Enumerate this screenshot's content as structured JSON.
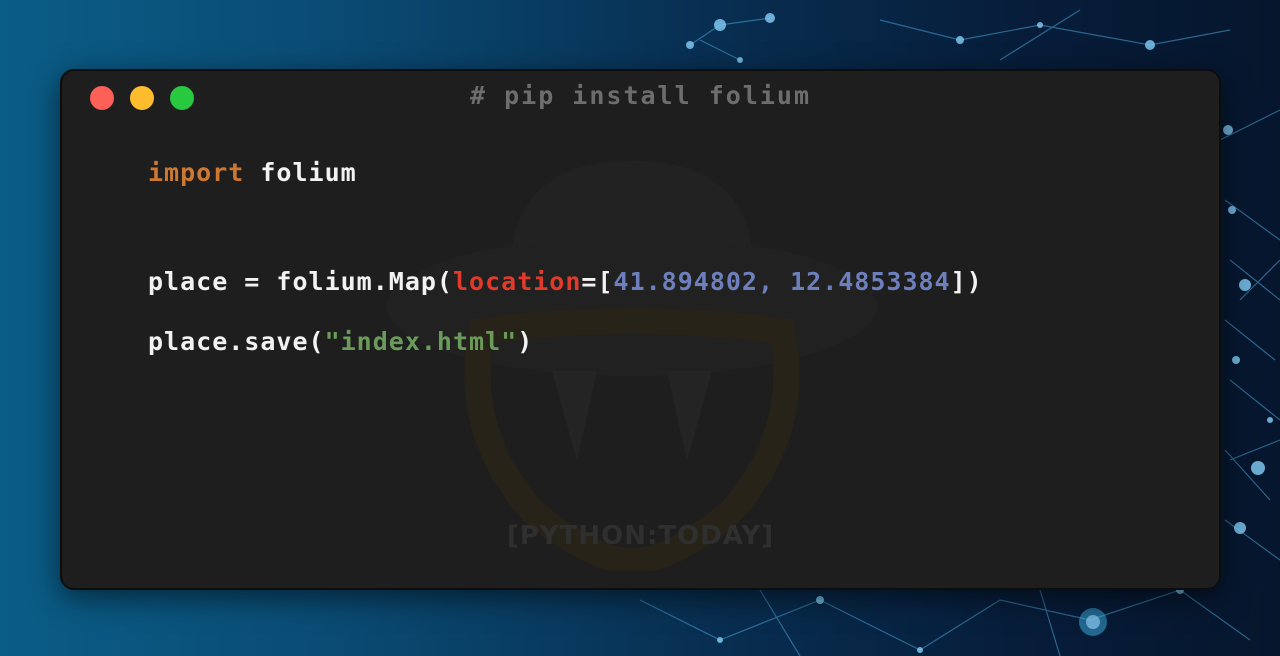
{
  "window": {
    "title": "# pip install folium",
    "buttons": {
      "close_color": "#fe5f57",
      "minimize_color": "#febc2e",
      "maximize_color": "#28c840"
    }
  },
  "code": {
    "line1": {
      "keyword": "import",
      "module": " folium"
    },
    "line2": {
      "prefix": "place = folium.Map(",
      "param": "location",
      "eq_bracket": "=[",
      "lat": "41.894802",
      "sep": ", ",
      "lon": "12.4853384",
      "suffix": "])"
    },
    "line3": {
      "prefix": "place.save(",
      "string": "\"index.html\"",
      "suffix": ")"
    }
  },
  "watermark": {
    "text": "[PYTHON:TODAY]"
  },
  "colors": {
    "keyword": "#cc7832",
    "param": "#e23a2a",
    "number": "#6d80bd",
    "string": "#6a9b5a",
    "window_bg": "#1e1e1e"
  }
}
